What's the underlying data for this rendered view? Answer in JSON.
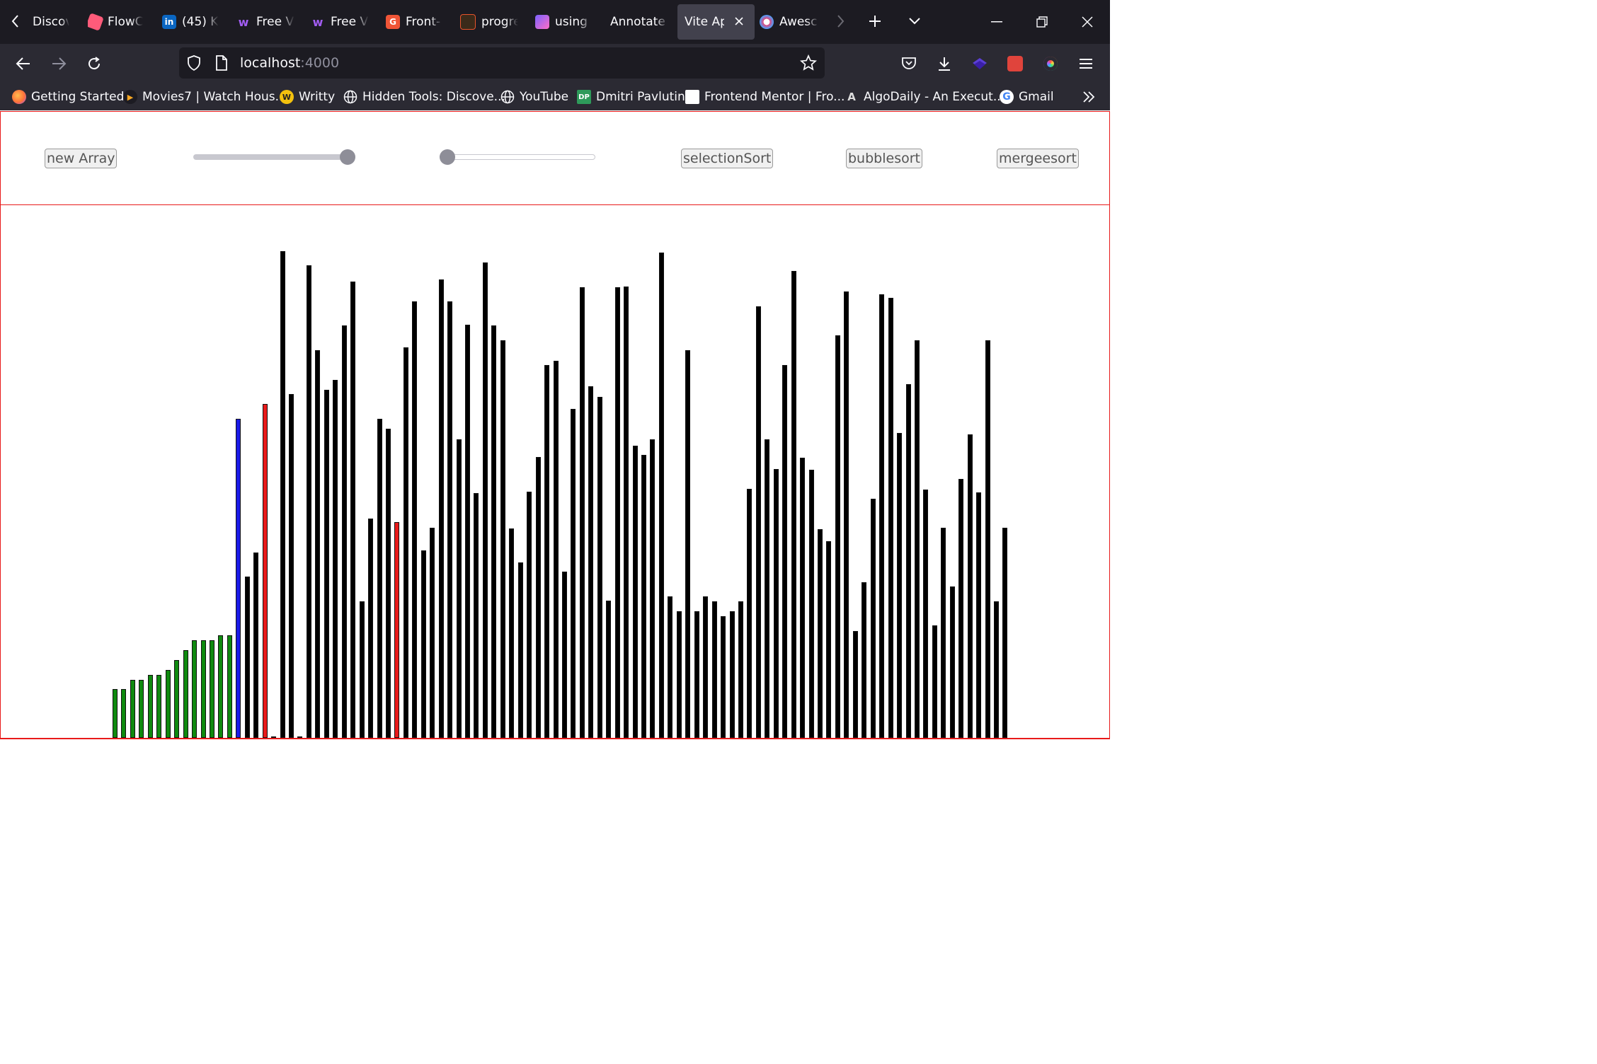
{
  "browser": {
    "tabs": [
      {
        "label": "Discov",
        "icon": "none",
        "color": ""
      },
      {
        "label": "FlowC",
        "icon": "flowcv-icon",
        "color": "#ff5b7a"
      },
      {
        "label": "(45) K",
        "icon": "linkedin-icon",
        "color": "#0a66c2"
      },
      {
        "label": "Free V",
        "icon": "webflow-icon",
        "color": "#a25df3"
      },
      {
        "label": "Free V",
        "icon": "webflow-icon",
        "color": "#a25df3"
      },
      {
        "label": "Front-",
        "icon": "g-icon",
        "color": "#f05537"
      },
      {
        "label": "progre",
        "icon": "progress-icon",
        "color": "#e8542b"
      },
      {
        "label": "using",
        "icon": "app-icon",
        "color": "#7b61ff"
      },
      {
        "label": "Annotate",
        "icon": "none",
        "color": ""
      },
      {
        "label": "Vite Ap",
        "icon": "none",
        "color": "",
        "active": true
      },
      {
        "label": "Awesc",
        "icon": "colorpicker-icon",
        "color": "#e2457a"
      }
    ],
    "url_host": "localhost",
    "url_port": ":4000",
    "bookmarks": [
      {
        "label": "Getting Started",
        "icon": "firefox-icon",
        "color": "#ff7139"
      },
      {
        "label": "Movies7 | Watch Hous...",
        "icon": "play-icon",
        "color": "#f5a623"
      },
      {
        "label": "Writty",
        "icon": "writty-icon",
        "color": "#f3c10e"
      },
      {
        "label": "Hidden Tools: Discove...",
        "icon": "globe-icon",
        "color": "#fbfbfe"
      },
      {
        "label": "YouTube",
        "icon": "globe-icon",
        "color": "#fbfbfe"
      },
      {
        "label": "Dmitri Pavlutin",
        "icon": "dp-icon",
        "color": "#2e9a5a"
      },
      {
        "label": "Frontend Mentor | Fro...",
        "icon": "fm-icon",
        "color": "#ffffff"
      },
      {
        "label": "AlgoDaily - An Execut...",
        "icon": "algodaily-icon",
        "color": "#cccccc"
      },
      {
        "label": "Gmail",
        "icon": "google-icon",
        "color": "#4285f4"
      }
    ]
  },
  "controls": {
    "new_array_label": "new Array",
    "size_slider_value": 1.0,
    "speed_slider_value": 0.0,
    "selection_sort_label": "selectionSort",
    "bubble_sort_label": "bubblesort",
    "merge_sort_label": "mergeesort"
  },
  "colors": {
    "sorted": "#0f8a0f",
    "current": "#1a1ae8",
    "compare": "#e81a1a",
    "unsorted": "#000000",
    "border": "#e81a1a"
  },
  "array": {
    "values": [
      69,
      69,
      82,
      82,
      89,
      89,
      96,
      110,
      124,
      138,
      138,
      138,
      145,
      145,
      451,
      228,
      262,
      472,
      1,
      688,
      486,
      1,
      668,
      548,
      492,
      506,
      583,
      645,
      193,
      310,
      451,
      437,
      305,
      552,
      617,
      265,
      297,
      648,
      617,
      422,
      584,
      346,
      672,
      583,
      562,
      296,
      248,
      348,
      397,
      527,
      533,
      235,
      465,
      637,
      497,
      482,
      194,
      637,
      638,
      413,
      400,
      422,
      686,
      200,
      179,
      548,
      179,
      200,
      193,
      172,
      179,
      193,
      352,
      610,
      422,
      380,
      527,
      660,
      396,
      379,
      295,
      278,
      569,
      631,
      151,
      220,
      338,
      627,
      622,
      431,
      500,
      562,
      351,
      159,
      297,
      214,
      366,
      429,
      347,
      562,
      193,
      297
    ],
    "states": [
      "sorted",
      "sorted",
      "sorted",
      "sorted",
      "sorted",
      "sorted",
      "sorted",
      "sorted",
      "sorted",
      "sorted",
      "sorted",
      "sorted",
      "sorted",
      "sorted",
      "current",
      "unsorted",
      "unsorted",
      "compare",
      "unsorted",
      "unsorted",
      "unsorted",
      "unsorted",
      "unsorted",
      "unsorted",
      "unsorted",
      "unsorted",
      "unsorted",
      "unsorted",
      "unsorted",
      "unsorted",
      "unsorted",
      "unsorted",
      "compare",
      "unsorted"
    ]
  }
}
